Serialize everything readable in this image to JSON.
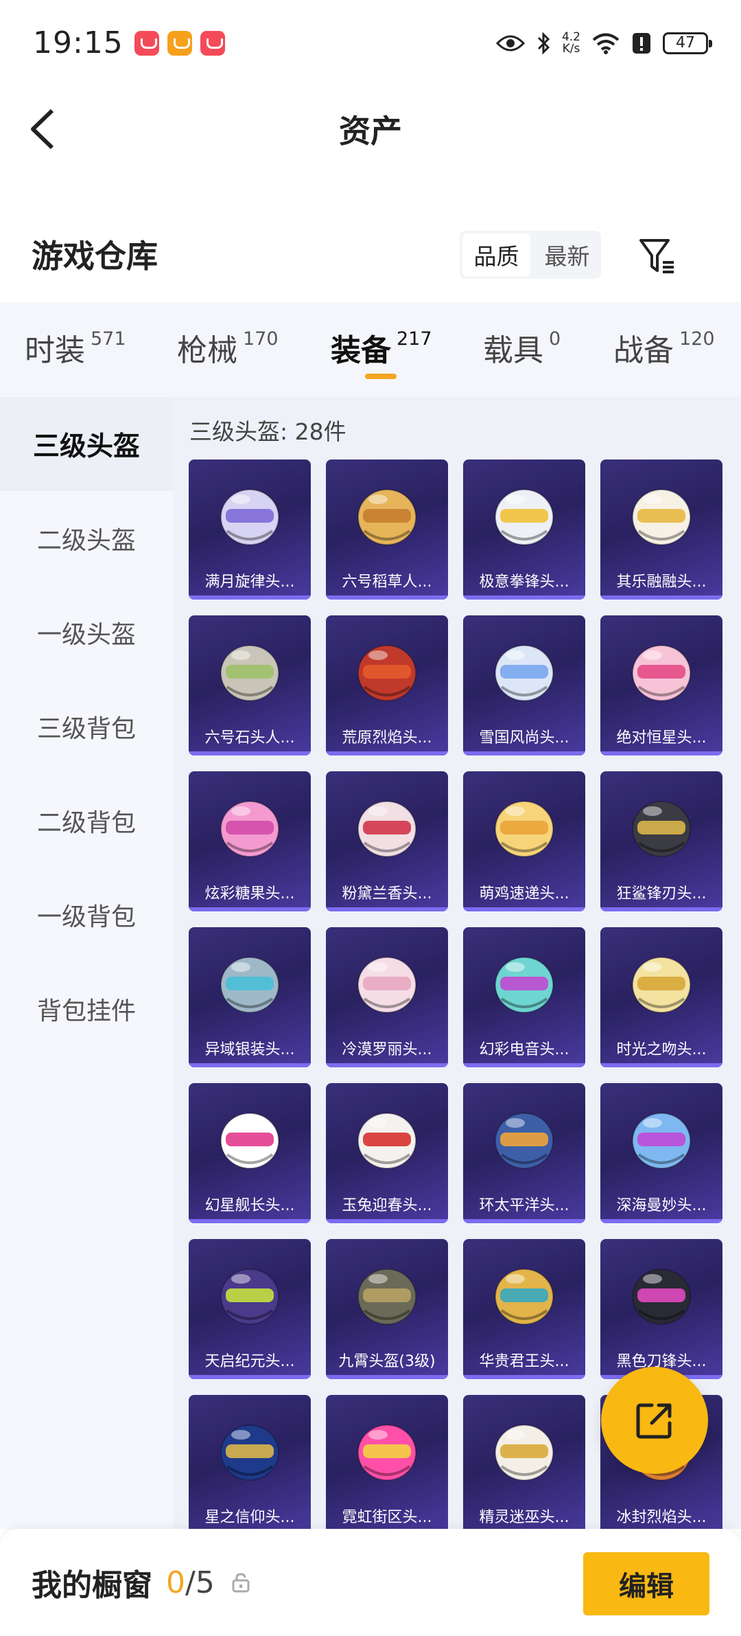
{
  "status_bar": {
    "time": "19:15",
    "net_speed_value": "4.2",
    "net_speed_unit": "K/s",
    "battery": "47",
    "icons": [
      "eye-icon",
      "bluetooth-icon",
      "wifi-icon",
      "alert-icon",
      "battery-icon"
    ]
  },
  "header": {
    "title": "资产"
  },
  "section": {
    "title": "游戏仓库",
    "sort_options": [
      "品质",
      "最新"
    ],
    "active_sort": "品质"
  },
  "categories": [
    {
      "label": "时装",
      "count": "571"
    },
    {
      "label": "枪械",
      "count": "170"
    },
    {
      "label": "装备",
      "count": "217",
      "active": true
    },
    {
      "label": "载具",
      "count": "0"
    },
    {
      "label": "战备",
      "count": "120"
    }
  ],
  "sidebar": {
    "items": [
      "三级头盔",
      "二级头盔",
      "一级头盔",
      "三级背包",
      "二级背包",
      "一级背包",
      "背包挂件"
    ],
    "active": "三级头盔"
  },
  "content": {
    "count_label": "三级头盔: 28件",
    "items": [
      {
        "name": "满月旋律头...",
        "color": "#d7d3f2",
        "accent": "#7f6ad8"
      },
      {
        "name": "六号稻草人...",
        "color": "#e6b55a",
        "accent": "#c77d2e"
      },
      {
        "name": "极意拳锋头...",
        "color": "#eef0f5",
        "accent": "#f0c23a"
      },
      {
        "name": "其乐融融头...",
        "color": "#f6f1e4",
        "accent": "#e7b842"
      },
      {
        "name": "六号石头人...",
        "color": "#c9c5b8",
        "accent": "#9fc06a"
      },
      {
        "name": "荒原烈焰头...",
        "color": "#c0392b",
        "accent": "#e35b2b"
      },
      {
        "name": "雪国风尚头...",
        "color": "#dde6f6",
        "accent": "#7aa6f0"
      },
      {
        "name": "绝对恒星头...",
        "color": "#f7c3d6",
        "accent": "#e44d86"
      },
      {
        "name": "炫彩糖果头...",
        "color": "#f49ad0",
        "accent": "#d14ca8"
      },
      {
        "name": "粉黛兰香头...",
        "color": "#f1dfe3",
        "accent": "#d3354a"
      },
      {
        "name": "萌鸡速递头...",
        "color": "#f7d47a",
        "accent": "#e9a43a"
      },
      {
        "name": "狂鲨锋刃头...",
        "color": "#3b3b44",
        "accent": "#d9b64a"
      },
      {
        "name": "异域银装头...",
        "color": "#9fb8c8",
        "accent": "#49c0d8"
      },
      {
        "name": "冷漠罗丽头...",
        "color": "#f5dde6",
        "accent": "#e8a8c0"
      },
      {
        "name": "幻彩电音头...",
        "color": "#6fd5d1",
        "accent": "#c04ad0"
      },
      {
        "name": "时光之吻头...",
        "color": "#f3e2a0",
        "accent": "#d8a93a"
      },
      {
        "name": "幻星舰长头...",
        "color": "#ffffff",
        "accent": "#e23a8e"
      },
      {
        "name": "玉兔迎春头...",
        "color": "#f4f1ee",
        "accent": "#d8322e"
      },
      {
        "name": "环太平洋头...",
        "color": "#3e5fa8",
        "accent": "#f0a43a"
      },
      {
        "name": "深海曼妙头...",
        "color": "#7fb8f0",
        "accent": "#c04ad8"
      },
      {
        "name": "天启纪元头...",
        "color": "#4a3a8a",
        "accent": "#c6e040"
      },
      {
        "name": "九霄头盔(3级)",
        "color": "#6b6a58",
        "accent": "#b7a264"
      },
      {
        "name": "华贵君王头...",
        "color": "#e2b44a",
        "accent": "#38a8c0"
      },
      {
        "name": "黑色刀锋头...",
        "color": "#2a2a36",
        "accent": "#e04ac0"
      },
      {
        "name": "星之信仰头...",
        "color": "#1e3a8a",
        "accent": "#d8b64a"
      },
      {
        "name": "霓虹街区头...",
        "color": "#ff4fa8",
        "accent": "#f5d040"
      },
      {
        "name": "精灵迷巫头...",
        "color": "#f4efe6",
        "accent": "#d8aa3a"
      },
      {
        "name": "冰封烈焰头...",
        "color": "#f08a3a",
        "accent": "#e24a2a"
      }
    ]
  },
  "bottom_bar": {
    "title": "我的橱窗",
    "used": "0",
    "total": "/5",
    "edit_label": "编辑"
  }
}
